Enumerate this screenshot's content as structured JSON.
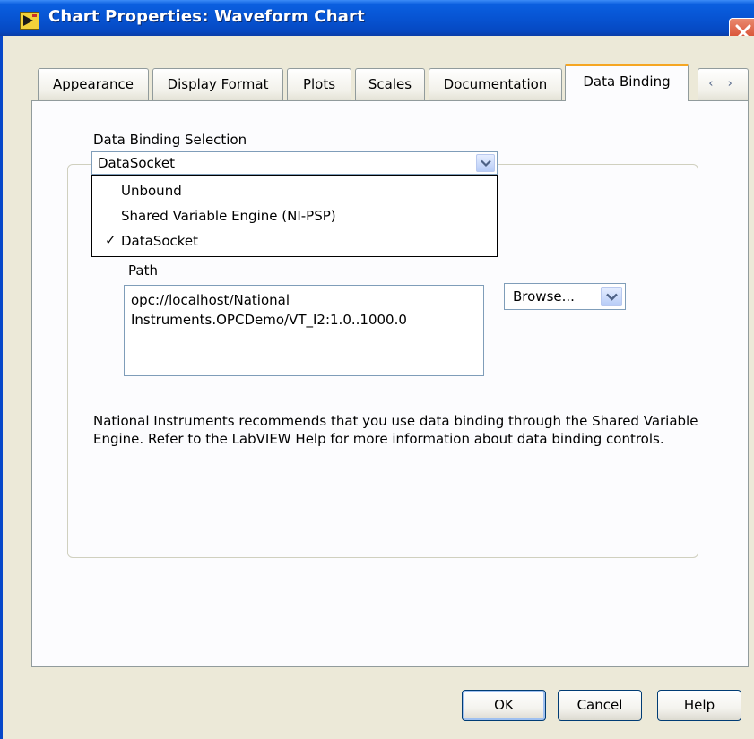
{
  "window": {
    "title": "Chart Properties: Waveform Chart",
    "icon": "labview-app-icon",
    "close_icon": "close-icon",
    "accent_color": "#0754d3",
    "close_color": "#d2391d"
  },
  "tabs": [
    {
      "label": "Appearance",
      "active": false
    },
    {
      "label": "Display Format",
      "active": false
    },
    {
      "label": "Plots",
      "active": false
    },
    {
      "label": "Scales",
      "active": false
    },
    {
      "label": "Documentation",
      "active": false
    },
    {
      "label": "Data Binding",
      "active": true
    }
  ],
  "tab_scroll": {
    "label": "‹ ›"
  },
  "data_binding": {
    "selection_label": "Data Binding Selection",
    "selected_value": "DataSocket",
    "options": [
      {
        "label": "Unbound",
        "checked": false
      },
      {
        "label": "Shared Variable Engine (NI-PSP)",
        "checked": false
      },
      {
        "label": "DataSocket",
        "checked": true
      }
    ],
    "check_mark": "✓",
    "path_label": "Path",
    "path_value": "opc://localhost/National\nInstruments.OPCDemo/VT_I2:1.0..1000.0",
    "browse_label": "Browse...",
    "note": "National Instruments recommends that you use data binding through the Shared Variable Engine.  Refer to the LabVIEW Help for more information about data binding controls."
  },
  "buttons": {
    "ok": "OK",
    "cancel": "Cancel",
    "help": "Help"
  }
}
